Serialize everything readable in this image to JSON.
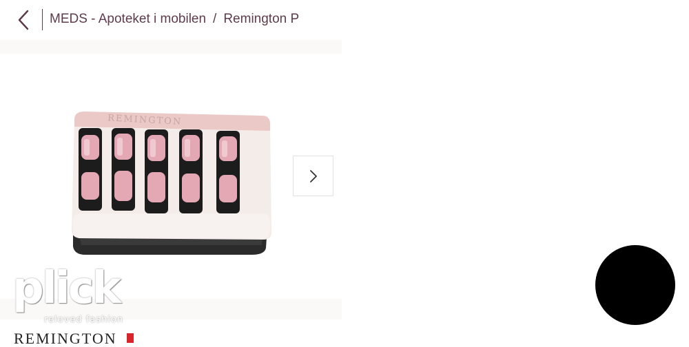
{
  "header": {
    "breadcrumb": [
      "MEDS - Apoteket i mobilen",
      "Remington P"
    ],
    "separator": "/"
  },
  "product": {
    "image_icon": "hair-rollers-product-image",
    "brand_on_device": "REMINGTON"
  },
  "carousel": {
    "next_icon": "chevron-right-icon"
  },
  "watermark": {
    "name": "plick",
    "tagline": "reloved fashion"
  },
  "footer": {
    "brand": "REMINGTON"
  },
  "colors": {
    "breadcrumb_text": "#5e3b4c",
    "accent_pink": "#e4a8b4",
    "brand_red": "#d8242b"
  }
}
